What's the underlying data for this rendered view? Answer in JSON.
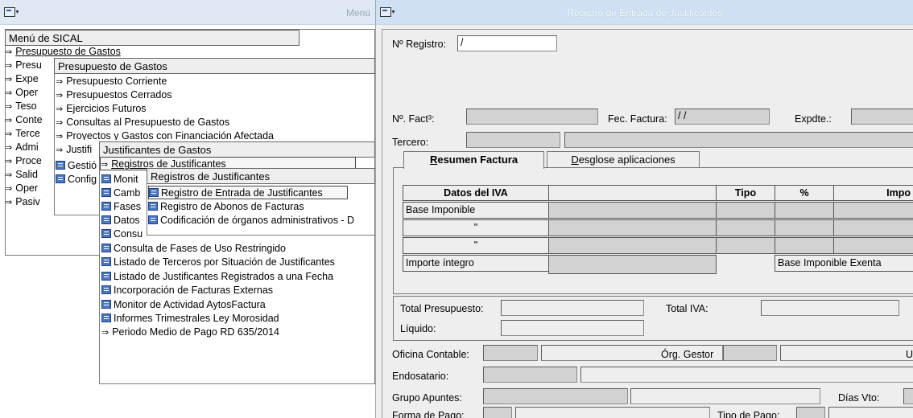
{
  "left_window": {
    "title": "Menú",
    "menu_root": {
      "header": "Menú de SICAL",
      "items": [
        {
          "label": "Presupuesto de Gastos",
          "selected": true
        },
        {
          "label": "Presu"
        },
        {
          "label": "Expe"
        },
        {
          "label": "Oper"
        },
        {
          "label": "Teso"
        },
        {
          "label": "Conte"
        },
        {
          "label": "Terce"
        },
        {
          "label": "Admi"
        },
        {
          "label": "Proce"
        },
        {
          "label": "Salid"
        },
        {
          "label": "Oper"
        },
        {
          "label": "Pasiv"
        }
      ]
    },
    "submenu_gastos": {
      "header": "Presupuesto de Gastos",
      "items": [
        {
          "label": "Presupuesto Corriente"
        },
        {
          "label": "Presupuestos Cerrados"
        },
        {
          "label": "Ejercicios Futuros"
        },
        {
          "label": "Consultas al Presupuesto de Gastos"
        },
        {
          "label": "Proyectos y Gastos con Financiación Afectada"
        },
        {
          "label": "Justifi"
        },
        {
          "label": "Gestió"
        },
        {
          "label": "Config"
        }
      ]
    },
    "submenu_justificantes": {
      "header": "Justificantes de Gastos",
      "items": [
        {
          "label": "Registros de Justificantes"
        },
        {
          "label": "Monit"
        },
        {
          "label": "Camb"
        },
        {
          "label": "Fases"
        },
        {
          "label": "Datos"
        },
        {
          "label": "Consu"
        },
        {
          "label": "Consulta de Fases de Uso Restringido"
        },
        {
          "label": "Listado de Terceros por Situación de Justificantes"
        },
        {
          "label": "Listado de Justificantes Registrados a una Fecha"
        },
        {
          "label": "Incorporación de Facturas Externas"
        },
        {
          "label": "Monitor de Actividad AytosFactura"
        },
        {
          "label": "Informes Trimestrales Ley Morosidad"
        },
        {
          "label": "Periodo Medio de Pago RD 635/2014"
        }
      ]
    },
    "submenu_registros": {
      "header": "Registros de Justificantes",
      "items": [
        {
          "label": "Registro de Entrada de Justificantes",
          "selected": true
        },
        {
          "label": "Registro de Abonos de Facturas"
        },
        {
          "label": "Codificación de órganos administrativos - D"
        }
      ]
    }
  },
  "right_window": {
    "title": "Registro de Entrada de Justificantes",
    "n_registro": {
      "label": "Nº Registro:",
      "value": "/"
    },
    "n_factura": {
      "label": "Nº. Fact³:",
      "value": ""
    },
    "fec_factura": {
      "label": "Fec. Factura:",
      "value": "/ /"
    },
    "expdte": {
      "label": "Expdte.:",
      "value": ""
    },
    "tercero": {
      "label": "Tercero:",
      "value": ""
    },
    "tabs": [
      {
        "label": "Resumen Factura",
        "mnemonic": "R",
        "rest": "esumen Factura",
        "active": true
      },
      {
        "label": "Desglose aplicaciones",
        "mnemonic": "D",
        "rest": "esglose aplicaciones",
        "active": false
      }
    ],
    "iva_table": {
      "headers": [
        "Datos del IVA",
        "",
        "Tipo",
        "%",
        "Impo"
      ],
      "rows": [
        "Base Imponible",
        "\"",
        "\"",
        "Importe íntegro"
      ],
      "base_exenta_label": "Base Imponible Exenta"
    },
    "totals": {
      "total_presupuesto": "Total Presupuesto:",
      "total_iva": "Total IVA:",
      "liquido": "Líquido:"
    },
    "oficina_contable": "Oficina Contable:",
    "org_gestor": "Órg. Gestor",
    "u_label": "U",
    "endosatario": "Endosatario:",
    "grupo_apuntes": "Grupo Apuntes:",
    "dias_vto": "Días Vto:",
    "forma_pago": "Forma de Pago:",
    "tipo_pago": "Tipo de Pago:"
  }
}
